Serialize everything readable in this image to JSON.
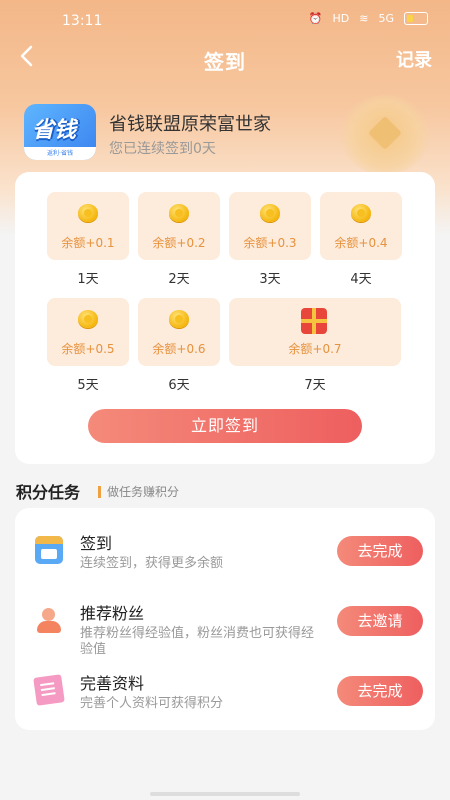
{
  "status_bar": {
    "time": "13:11",
    "network": "HD",
    "signal": "5G"
  },
  "nav": {
    "back_icon": "chevron-left-icon",
    "title": "签到",
    "record": "记录"
  },
  "profile": {
    "avatar_text": "省钱",
    "avatar_caption": "返利·省钱",
    "name": "省钱联盟原荣富世家",
    "streak": "您已连续签到0天"
  },
  "checkin": {
    "days": [
      {
        "reward": "余额+0.1",
        "label": "1天"
      },
      {
        "reward": "余额+0.2",
        "label": "2天"
      },
      {
        "reward": "余额+0.3",
        "label": "3天"
      },
      {
        "reward": "余额+0.4",
        "label": "4天"
      },
      {
        "reward": "余额+0.5",
        "label": "5天"
      },
      {
        "reward": "余额+0.6",
        "label": "6天"
      },
      {
        "reward": "余额+0.7",
        "label": "7天"
      }
    ],
    "button": "立即签到"
  },
  "tasks": {
    "title": "积分任务",
    "subtitle": "做任务赚积分",
    "items": [
      {
        "icon": "calendar-icon",
        "name": "签到",
        "desc": "连续签到，获得更多余额",
        "button": "去完成"
      },
      {
        "icon": "fans-icon",
        "name": "推荐粉丝",
        "desc": "推荐粉丝得经验值，粉丝消费也可获得经验值",
        "button": "去邀请"
      },
      {
        "icon": "document-icon",
        "name": "完善资料",
        "desc": "完善个人资料可获得积分",
        "button": "去完成"
      }
    ]
  },
  "colors": {
    "accent": "#ee5f5f",
    "header": "#f3b788",
    "reward_text": "#e7923d"
  }
}
